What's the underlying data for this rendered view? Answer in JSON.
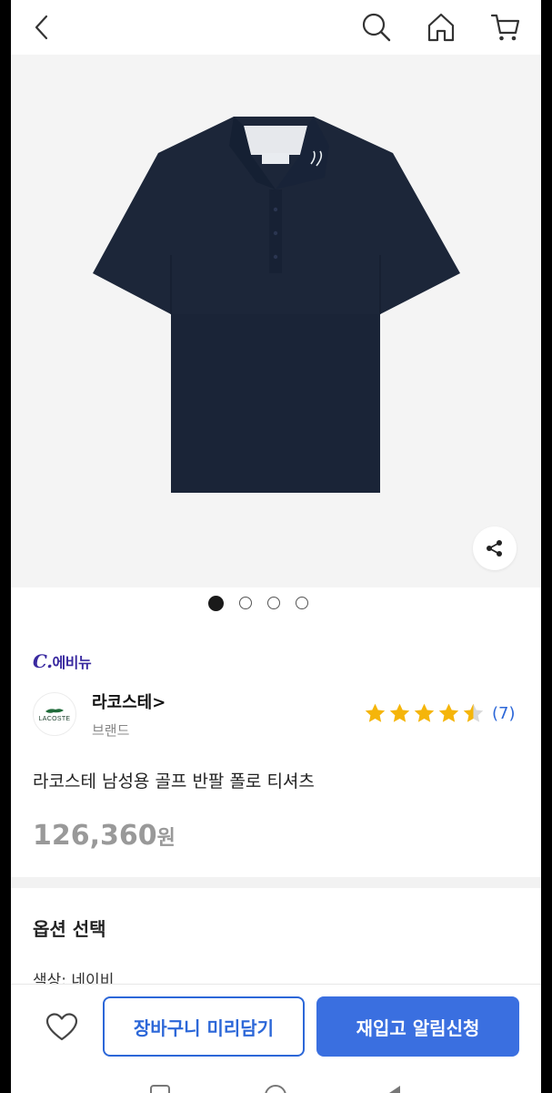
{
  "product": {
    "partner": "C.에비뉴",
    "partner_prefix": "C.",
    "partner_suffix": "에비뉴",
    "brand_name": "라코스테>",
    "brand_sub": "브랜드",
    "brand_logo_text": "LACOSTE",
    "title": "라코스테 남성용 골프 반팔 폴로 티셔츠",
    "price": "126,360",
    "price_unit": "원",
    "rating": 4.5,
    "review_count": "(7)"
  },
  "gallery": {
    "current_page": 1,
    "page_count": 4
  },
  "options": {
    "title": "옵션 선택",
    "color_line": "색상: 네이비"
  },
  "actions": {
    "cart_label": "장바구니 미리담기",
    "restock_label": "재입고 알림신청"
  },
  "colors": {
    "accent": "#2C67D8",
    "partner": "#3A2AA0",
    "star": "#F5B50A",
    "shirt": "#1C2639"
  },
  "icons": {
    "back": "chevron-left-icon",
    "search": "search-icon",
    "home": "home-icon",
    "cart": "cart-icon",
    "share": "share-icon",
    "wish": "heart-icon"
  }
}
